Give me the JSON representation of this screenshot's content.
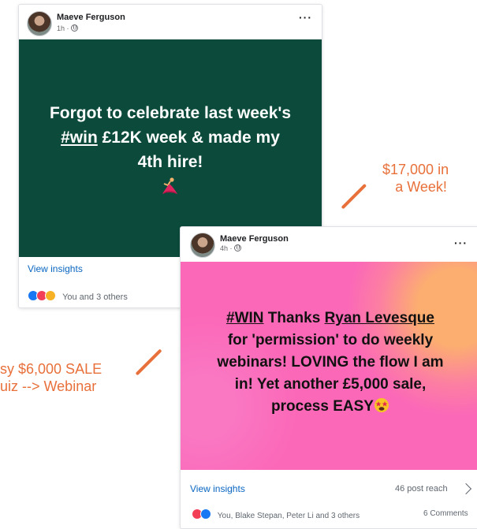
{
  "post1": {
    "author": "Maeve Ferguson",
    "time": "1h ·",
    "line1": "Forgot to celebrate last week's",
    "hashtag": "#win",
    "line2_rest": " £12K week & made my",
    "line3": "4th hire!",
    "view_insights": "View insights",
    "reactions_text": "You and 3 others",
    "bg_color": "#0c4b3b"
  },
  "post2": {
    "author": "Maeve Ferguson",
    "time": "4h ·",
    "hashtag": "#WIN",
    "thanks": " Thanks ",
    "mention": "Ryan Levesque",
    "line2": "for 'permission' to do weekly",
    "line3": "webinars! LOVING the flow I am",
    "line4": "in! Yet another £5,000 sale,",
    "line5": "process EASY",
    "view_insights": "View insights",
    "reach": "46 post reach",
    "reactions_text": "You, Blake Stepan, Peter Li and 3 others",
    "comments": "6 Comments",
    "bg_color": "#fb68b8"
  },
  "annotations": {
    "right_line1": "$17,000 in",
    "right_line2": "a Week!",
    "left_line1": "sy $6,000 SALE",
    "left_line2": "uiz --> Webinar",
    "color": "#e8703a"
  },
  "more_label": "···"
}
